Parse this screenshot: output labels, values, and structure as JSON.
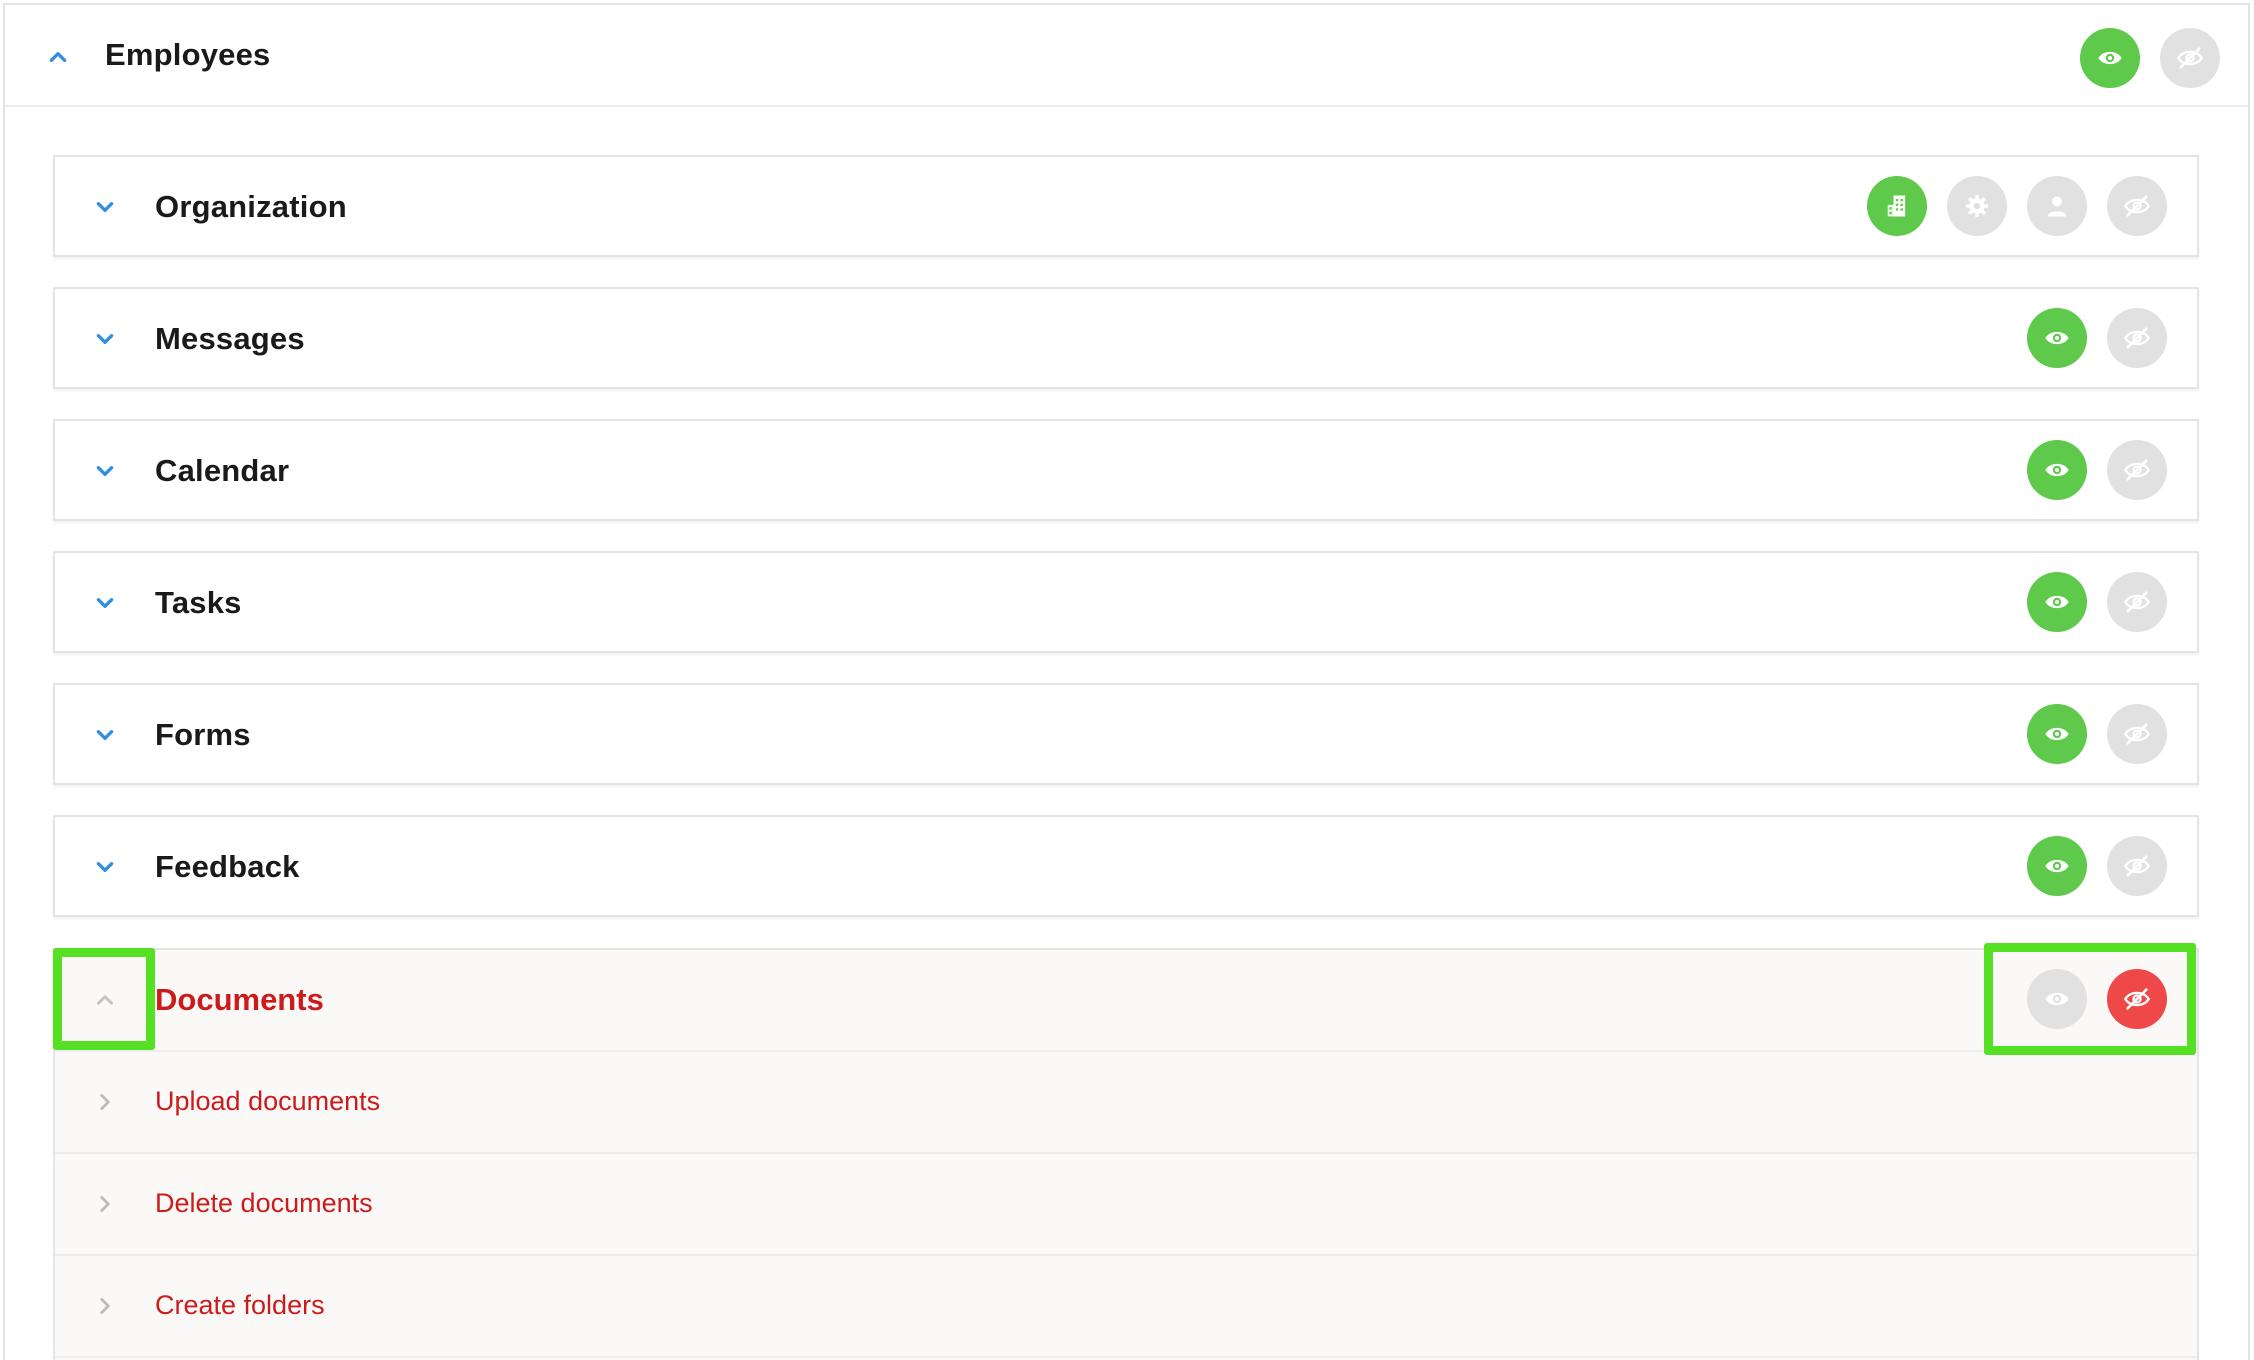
{
  "outer": {
    "title": "Employees",
    "icons": [
      "chevron-up-icon",
      "eye-icon",
      "eye-slash-icon"
    ]
  },
  "sections": [
    {
      "title": "Organization",
      "buttons": [
        "building-icon",
        "gear-icon",
        "user-icon",
        "eye-slash-icon"
      ]
    },
    {
      "title": "Messages",
      "buttons": [
        "eye-icon",
        "eye-slash-icon"
      ]
    },
    {
      "title": "Calendar",
      "buttons": [
        "eye-icon",
        "eye-slash-icon"
      ]
    },
    {
      "title": "Tasks",
      "buttons": [
        "eye-icon",
        "eye-slash-icon"
      ]
    },
    {
      "title": "Forms",
      "buttons": [
        "eye-icon",
        "eye-slash-icon"
      ]
    },
    {
      "title": "Feedback",
      "buttons": [
        "eye-icon",
        "eye-slash-icon"
      ]
    }
  ],
  "documents": {
    "title": "Documents",
    "items": [
      {
        "label": "Upload documents"
      },
      {
        "label": "Delete documents"
      },
      {
        "label": "Create folders"
      }
    ]
  },
  "colors": {
    "active_green": "#5ec94a",
    "inactive_grey": "#e1e1e1",
    "hidden_red": "#ef4848",
    "chevron_blue": "#2f8fe0",
    "denied_text": "#cc1b1b",
    "highlight": "#56e024"
  }
}
